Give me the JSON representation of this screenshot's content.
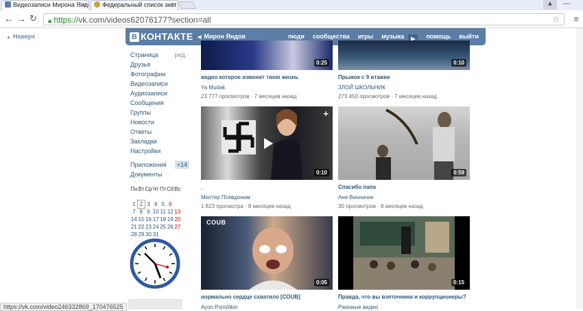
{
  "browser": {
    "tabs": [
      {
        "title": "Видеозаписи Мирона Яндова",
        "active": true
      },
      {
        "title": "Федеральный список экст",
        "active": false
      }
    ],
    "url_scheme": "https://",
    "url_rest": "vk.com/videos62076177?section=all",
    "status_url": "https://vk.com/video246332869_170476525"
  },
  "vk": {
    "logo": "КОНТАКТЕ",
    "logo_letter": "В",
    "user": "Мирон Яндов",
    "nav": [
      "люди",
      "сообщества",
      "игры",
      "музыка",
      "помощь",
      "выйти"
    ],
    "back_top": "Наверх"
  },
  "menu": {
    "items": [
      "Страница",
      "Друзья",
      "Фотографии",
      "Видеозаписи",
      "Аудиозаписи",
      "Сообщения",
      "Группы",
      "Новости",
      "Ответы",
      "Закладки",
      "Настройки"
    ],
    "edit": "ред.",
    "apps": "Приложения",
    "apps_badge": "+14",
    "docs": "Документы"
  },
  "calendar": {
    "weekdays": [
      "Пн",
      "Вт",
      "Ср",
      "Чт",
      "Пт",
      "Сб",
      "Вс"
    ],
    "weeks": [
      [
        "",
        "",
        "",
        "",
        "",
        "",
        ""
      ],
      [
        "1",
        "2",
        "3",
        "4",
        "5",
        "6",
        ""
      ],
      [
        "7",
        "8",
        "9",
        "10",
        "11",
        "12",
        "13"
      ],
      [
        "14",
        "15",
        "16",
        "17",
        "18",
        "19",
        "20"
      ],
      [
        "21",
        "22",
        "23",
        "24",
        "25",
        "26",
        "27"
      ],
      [
        "28",
        "29",
        "30",
        "31",
        "",
        "",
        ""
      ]
    ]
  },
  "videos": [
    {
      "title": "видео которое изменит твою жизнь",
      "author": "Ya Mudak",
      "meta": "23 777 просмотров  ·  7 месяцев назад",
      "duration": "0:25"
    },
    {
      "title": "Прыжок с 9 итажки",
      "author": "ЗЛОЙ ШКОЛЬНИК",
      "meta": "273 450 просмотров  ·  7 месяцев назад",
      "duration": "0:10"
    },
    {
      "title": "_",
      "author": "Мистер Псевдоним",
      "meta": "1 823 просмотра  ·  8 месяцев назад",
      "duration": "0:10"
    },
    {
      "title": "Спасибо папа",
      "author": "Аня Винничек",
      "meta": "30 просмотров  ·  8 месяцев назад",
      "duration": "0:59"
    },
    {
      "title": "нормально сердце схватило [COUB]",
      "author": "Ayon Pomōtkin",
      "meta": "",
      "duration": "0:05",
      "badge": "COUB"
    },
    {
      "title": "Правда, что вы взяточники и коррупционеры?",
      "author": "Ржачные видео",
      "meta": "",
      "duration": "0:15"
    }
  ],
  "colors": {
    "vk_blue": "#5b7da6",
    "link": "#2b587a",
    "red": "#c00000"
  }
}
